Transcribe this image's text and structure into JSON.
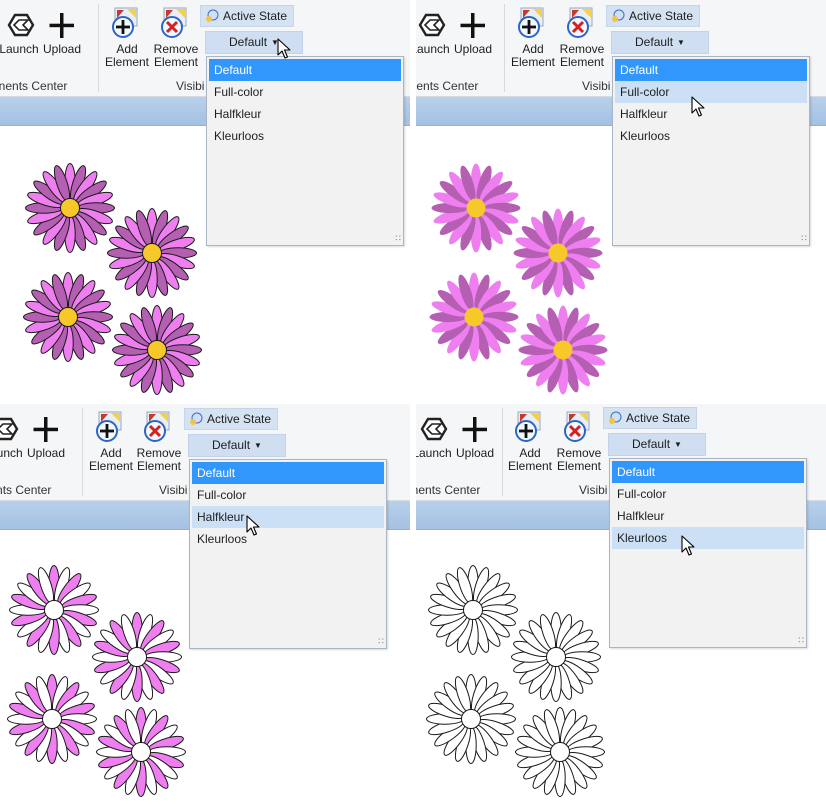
{
  "ribbon": {
    "launch_label": "Launch",
    "upload_label": "Upload",
    "add_element_label": [
      "Add",
      "Element"
    ],
    "remove_element_label": [
      "Remove",
      "Element"
    ],
    "active_state_label": "Active State",
    "group_components": "Components Center",
    "group_visibility": "Visibi"
  },
  "combo": {
    "value": "Default",
    "options": [
      "Default",
      "Full-color",
      "Halfkleur",
      "Kleurloos"
    ],
    "selected_index": 0
  },
  "panels": [
    {
      "hover_index": null,
      "theme": "default"
    },
    {
      "hover_index": 1,
      "theme": "full-color"
    },
    {
      "hover_index": 2,
      "theme": "halfkleur"
    },
    {
      "hover_index": 3,
      "theme": "kleurloos"
    }
  ],
  "colors": {
    "selected_option": "#3297fd",
    "hover_option": "#cce0f5",
    "header_bar": "#a9c5e5",
    "flower_center_yellow": "#f6c82a"
  },
  "themes": {
    "default": {
      "petal_light": "#ef7ff0",
      "petal_dark": "#b45fb2",
      "center": "#f6c82a",
      "stroke": "#1a1a1a"
    },
    "full-color": {
      "petal_light": "#ef7ff0",
      "petal_dark": "#b45fb2",
      "center": "#f6c82a",
      "stroke": "none"
    },
    "halfkleur": {
      "petal_light": "#ef7ff0",
      "petal_dark": "#ffffff",
      "center": "#ffffff",
      "stroke": "#1a1a1a"
    },
    "kleurloos": {
      "petal_light": "#ffffff",
      "petal_dark": "#ffffff",
      "center": "#ffffff",
      "stroke": "#1a1a1a"
    }
  }
}
